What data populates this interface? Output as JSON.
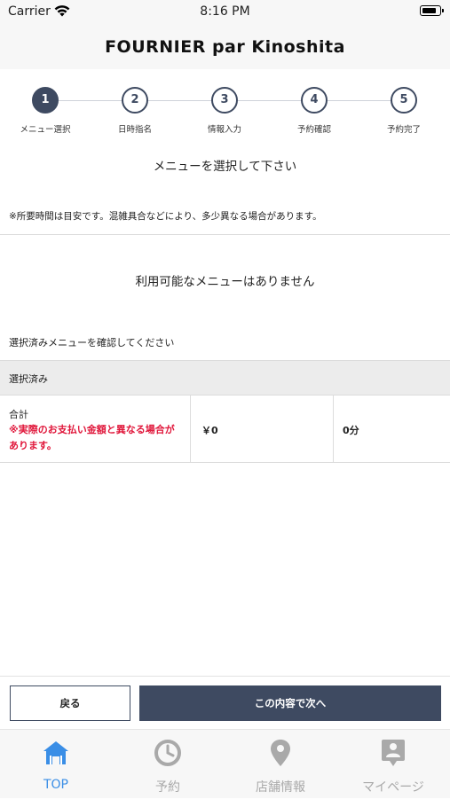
{
  "status_bar": {
    "carrier": "Carrier",
    "time": "8:16 PM"
  },
  "nav": {
    "title": "FOURNIER par Kinoshita"
  },
  "steps": [
    {
      "number": "1",
      "label": "メニュー選択"
    },
    {
      "number": "2",
      "label": "日時指名"
    },
    {
      "number": "3",
      "label": "情報入力"
    },
    {
      "number": "4",
      "label": "予約確認"
    },
    {
      "number": "5",
      "label": "予約完了"
    }
  ],
  "main": {
    "instruction": "メニューを選択して下さい",
    "note": "※所要時間は目安です。混雑具合などにより、多少異なる場合があります。",
    "empty_message": "利用可能なメニューはありません",
    "confirm_hint": "選択済みメニューを確認してください",
    "selected_header": "選択済み",
    "summary": {
      "total_label": "合計",
      "warning": "※実際のお支払い金額と異なる場合があります。",
      "price": "￥0",
      "duration": "0分"
    }
  },
  "actions": {
    "back_label": "戻る",
    "next_label": "この内容で次へ"
  },
  "tabs": [
    {
      "label": "TOP",
      "icon": "home-icon"
    },
    {
      "label": "予約",
      "icon": "clock-icon"
    },
    {
      "label": "店舗情報",
      "icon": "location-pin-icon"
    },
    {
      "label": "マイページ",
      "icon": "profile-card-icon"
    }
  ],
  "colors": {
    "accent": "#3e4a61",
    "warning": "#e0163a",
    "tab_active": "#3a8ee6",
    "tab_inactive": "#a9a9a9"
  }
}
